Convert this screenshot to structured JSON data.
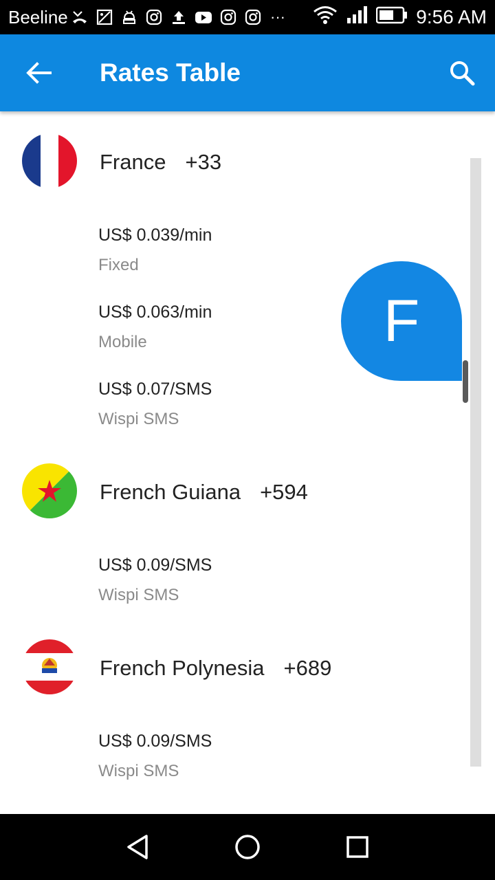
{
  "status_bar": {
    "carrier": "Beeline",
    "time": "9:56 AM",
    "notification_icons": [
      "missed-call-icon",
      "image-icon",
      "android-debug-icon",
      "instagram-icon",
      "upload-icon",
      "youtube-icon",
      "instagram-icon",
      "instagram-icon",
      "more-dots-icon"
    ],
    "more": "···"
  },
  "app_bar": {
    "title": "Rates Table"
  },
  "countries": [
    {
      "name": "France",
      "code": "+33",
      "flag": "france-flag",
      "rates": [
        {
          "value": "US$ 0.039/min",
          "type": "Fixed"
        },
        {
          "value": "US$ 0.063/min",
          "type": "Mobile"
        },
        {
          "value": "US$ 0.07/SMS",
          "type": "Wispi SMS"
        }
      ]
    },
    {
      "name": "French Guiana",
      "code": "+594",
      "flag": "french-guiana-flag",
      "rates": [
        {
          "value": "US$ 0.09/SMS",
          "type": "Wispi SMS"
        }
      ]
    },
    {
      "name": "French Polynesia",
      "code": "+689",
      "flag": "french-polynesia-flag",
      "rates": [
        {
          "value": "US$ 0.09/SMS",
          "type": "Wispi SMS"
        }
      ]
    }
  ],
  "index_bubble": {
    "letter": "F"
  },
  "colors": {
    "accent": "#0e88e0",
    "bubble": "#1387e3",
    "secondary_text": "#8a8a8a"
  }
}
